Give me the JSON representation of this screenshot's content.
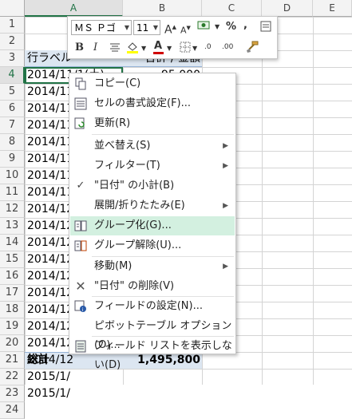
{
  "columns": [
    "A",
    "B",
    "C",
    "D",
    "E"
  ],
  "selected_column": "A",
  "rows": [
    "1",
    "2",
    "3",
    "4",
    "5",
    "6",
    "7",
    "8",
    "9",
    "10",
    "11",
    "12",
    "13",
    "14",
    "15",
    "16",
    "17",
    "18",
    "19",
    "20",
    "21",
    "22",
    "23",
    "24"
  ],
  "selected_row": "4",
  "header_row": {
    "label": "行ラベル",
    "value": "合計 / 金額"
  },
  "data_rows": [
    {
      "label": "2014/11/1(土)",
      "value": "95,000"
    },
    {
      "label": "2014/11",
      "value": ""
    },
    {
      "label": "2014/11",
      "value": ""
    },
    {
      "label": "2014/11",
      "value": ""
    },
    {
      "label": "2014/11",
      "value": ""
    },
    {
      "label": "2014/11",
      "value": ""
    },
    {
      "label": "2014/11",
      "value": ""
    },
    {
      "label": "2014/11",
      "value": ""
    },
    {
      "label": "2014/12",
      "value": ""
    },
    {
      "label": "2014/12",
      "value": ""
    },
    {
      "label": "2014/12",
      "value": ""
    },
    {
      "label": "2014/12",
      "value": ""
    },
    {
      "label": "2014/12",
      "value": ""
    },
    {
      "label": "2014/12",
      "value": ""
    },
    {
      "label": "2014/12",
      "value": ""
    },
    {
      "label": "2014/12",
      "value": ""
    },
    {
      "label": "2014/12",
      "value": ""
    },
    {
      "label": "2014/12",
      "value": ""
    },
    {
      "label": "2015/1/",
      "value": ""
    },
    {
      "label": "2015/1/",
      "value": ""
    }
  ],
  "total_row": {
    "label": "総計",
    "value": "1,495,800"
  },
  "mini_toolbar": {
    "font_name": "ＭＳ Ｐゴ",
    "font_size": "11",
    "grow_font": "A",
    "shrink_font": "A",
    "percent": "%",
    "comma": ",",
    "bold": "B",
    "italic": "I",
    "font_color_letter": "A",
    "dec_inc": ".0",
    "dec_dec": ".00"
  },
  "context_menu": [
    {
      "label": "コピー(C)",
      "icon": "copy-icon",
      "submenu": false
    },
    {
      "label": "セルの書式設定(F)...",
      "icon": "format-cells-icon",
      "submenu": false
    },
    {
      "label": "更新(R)",
      "icon": "refresh-icon",
      "submenu": false
    },
    {
      "label": "並べ替え(S)",
      "icon": "",
      "submenu": true
    },
    {
      "label": "フィルター(T)",
      "icon": "",
      "submenu": true
    },
    {
      "label": "\"日付\" の小計(B)",
      "icon": "checkmark-icon",
      "submenu": false
    },
    {
      "label": "展開/折りたたみ(E)",
      "icon": "",
      "submenu": true
    },
    {
      "label": "グループ化(G)...",
      "icon": "group-icon",
      "submenu": false,
      "highlighted": true
    },
    {
      "label": "グループ解除(U)...",
      "icon": "ungroup-icon",
      "submenu": false
    },
    {
      "label": "移動(M)",
      "icon": "",
      "submenu": true
    },
    {
      "label": "\"日付\" の削除(V)",
      "icon": "delete-x-icon",
      "submenu": false
    },
    {
      "label": "フィールドの設定(N)...",
      "icon": "field-settings-icon",
      "submenu": false
    },
    {
      "label": "ピボットテーブル オプション(O)...",
      "icon": "",
      "submenu": false
    },
    {
      "label": "フィールド リストを表示しない(D)",
      "icon": "field-list-icon",
      "submenu": false
    }
  ],
  "colors": {
    "accent": "#217346",
    "band": "#dce6f1",
    "highlight": "#d3f0e0",
    "font_red": "#d00000",
    "fill_yellow": "#ffff00"
  }
}
